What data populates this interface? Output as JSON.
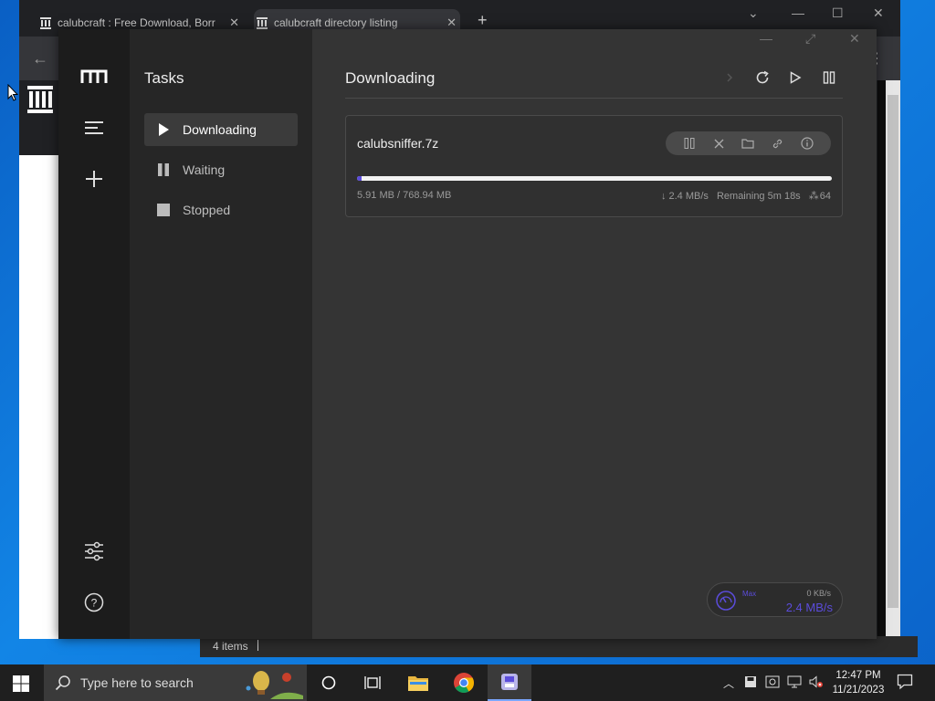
{
  "browser": {
    "tabs": [
      {
        "title": "calubcraft : Free Download, Borr"
      },
      {
        "title": "calubcraft directory listing"
      }
    ],
    "new_tab_symbol": "+",
    "status": {
      "items_count": "4 items"
    }
  },
  "app": {
    "sidebar_title": "Tasks",
    "nav": [
      {
        "label": "Downloading",
        "icon": "play-icon",
        "active": true
      },
      {
        "label": "Waiting",
        "icon": "pause-icon"
      },
      {
        "label": "Stopped",
        "icon": "stop-icon"
      }
    ],
    "main_title": "Downloading",
    "task": {
      "file_name": "calubsniffer.7z",
      "progress": "5.91 MB / 768.94 MB",
      "progress_fraction": 0.0077,
      "speed": "↓ 2.4 MB/s",
      "remaining": "Remaining 5m 18s",
      "connections": "64"
    },
    "speedometer": {
      "label": "Max",
      "upload": "0 KB/s",
      "download": "2.4 MB/s"
    },
    "colors": {
      "accent": "#5b4cdb"
    }
  },
  "taskbar": {
    "search_placeholder": "Type here to search",
    "time": "12:47 PM",
    "date": "11/21/2023"
  }
}
